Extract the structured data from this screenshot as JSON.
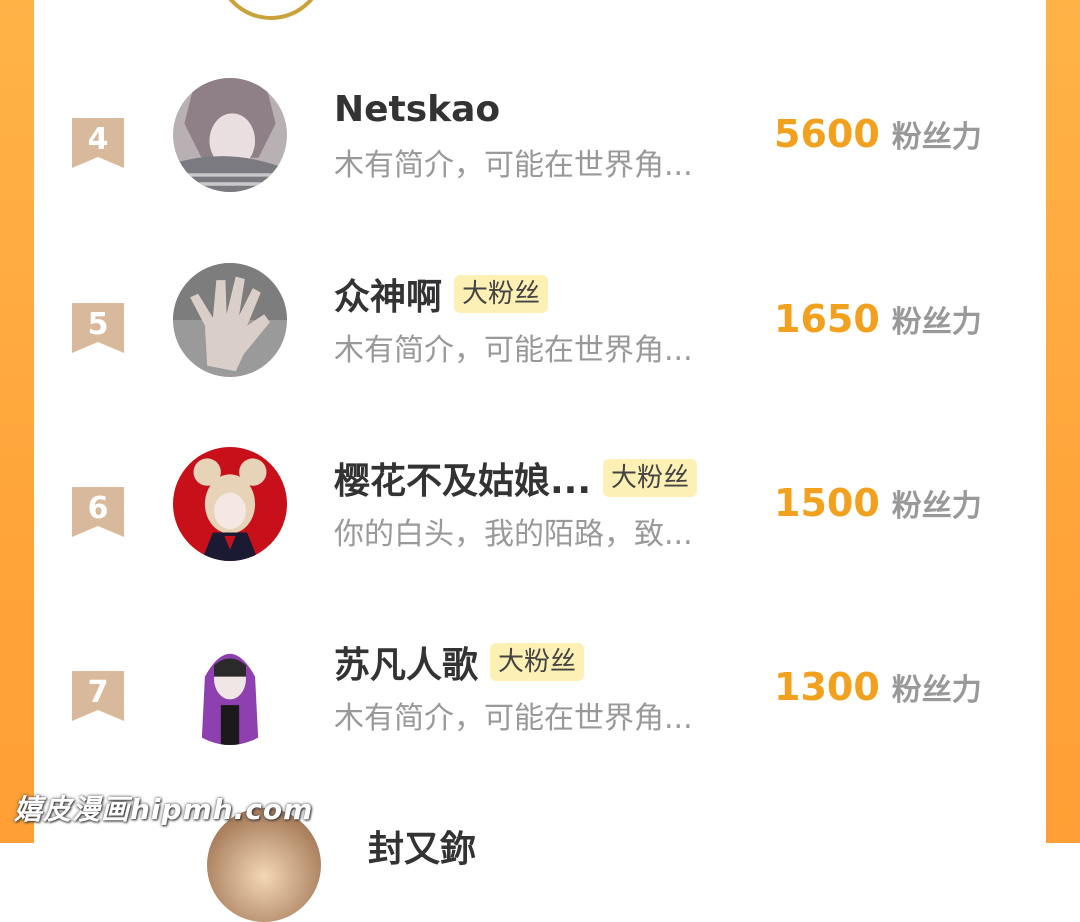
{
  "rows": [
    {
      "rank": "4",
      "name": "Netskao",
      "badge": "",
      "bio": "木有简介，可能在世界角...",
      "score": "5600",
      "unit": "粉丝力",
      "avatar": "anime-character-avatar"
    },
    {
      "rank": "5",
      "name": "众神啊",
      "badge": "大粉丝",
      "bio": "木有简介，可能在世界角...",
      "score": "1650",
      "unit": "粉丝力",
      "avatar": "hand-photo-avatar"
    },
    {
      "rank": "6",
      "name": "樱花不及姑娘...",
      "badge": "大粉丝",
      "bio": "你的白头，我的陌路，致...",
      "score": "1500",
      "unit": "粉丝力",
      "avatar": "red-anime-girl-avatar"
    },
    {
      "rank": "7",
      "name": "苏凡人歌",
      "badge": "大粉丝",
      "bio": "木有简介，可能在世界角...",
      "score": "1300",
      "unit": "粉丝力",
      "avatar": "purple-hoodie-avatar"
    }
  ],
  "partial_next_row": {
    "name": "封又鉨"
  },
  "watermark": "嬉皮漫画hipmh.com",
  "colors": {
    "frame": "#ffa53a",
    "score": "#f2a11f",
    "badge_bg": "#fdf0b4",
    "rank_ribbon": "#d9b99b"
  }
}
